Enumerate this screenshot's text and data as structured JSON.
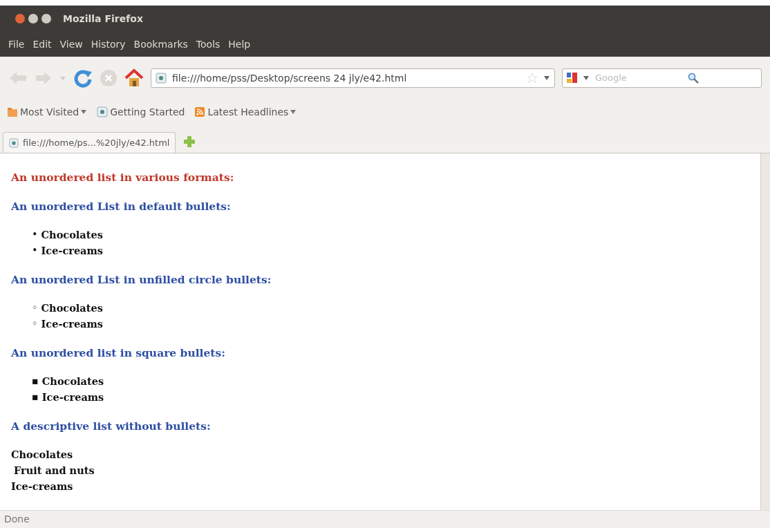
{
  "window": {
    "title": "Mozilla Firefox"
  },
  "menu": [
    "File",
    "Edit",
    "View",
    "History",
    "Bookmarks",
    "Tools",
    "Help"
  ],
  "navigation": {
    "address": "file:///home/pss/Desktop/screens 24 jly/e42.html",
    "search_placeholder": "Google"
  },
  "bookmarks": [
    {
      "label": "Most Visited",
      "kind": "folder",
      "dropdown": true
    },
    {
      "label": "Getting Started",
      "kind": "page",
      "dropdown": false
    },
    {
      "label": "Latest Headlines",
      "kind": "feed",
      "dropdown": true
    }
  ],
  "tabs": [
    {
      "label": "file:///home/ps...%20jly/e42.html",
      "selected": true
    }
  ],
  "content": [
    {
      "kind": "heading",
      "text": "An unordered list in various formats:",
      "color": "#c0392b"
    },
    {
      "kind": "heading",
      "text": "An unordered List in default bullets:",
      "color": "#2e4fa3"
    },
    {
      "kind": "list",
      "marker": "•",
      "items": [
        "Chocolates",
        "Ice-creams"
      ]
    },
    {
      "kind": "heading",
      "text": "An unordered List in unfilled circle bullets:",
      "color": "#2e4fa3"
    },
    {
      "kind": "list",
      "marker": "◦",
      "items": [
        "Chocolates",
        "Ice-creams"
      ]
    },
    {
      "kind": "heading",
      "text": "An unordered list in square bullets:",
      "color": "#2e4fa3"
    },
    {
      "kind": "list",
      "marker": "▪",
      "items": [
        "Chocolates",
        "Ice-creams"
      ]
    },
    {
      "kind": "heading",
      "text": "A descriptive list without bullets:",
      "color": "#2e4fa3"
    },
    {
      "kind": "definitions",
      "items": [
        {
          "kind": "term",
          "text": "Chocolates"
        },
        {
          "kind": "description",
          "text": "Fruit and nuts"
        },
        {
          "kind": "term",
          "text": "Ice-creams"
        }
      ]
    }
  ],
  "status_bar": "Done"
}
